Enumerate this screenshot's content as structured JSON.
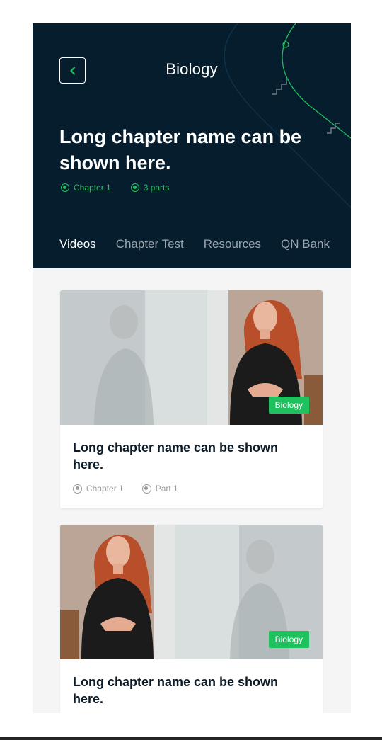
{
  "header": {
    "title": "Biology",
    "chapter_heading": "Long chapter name can be shown here.",
    "meta": [
      {
        "icon": "radio-icon",
        "label": "Chapter 1"
      },
      {
        "icon": "radio-icon",
        "label": "3 parts"
      }
    ],
    "back_icon": "chevron-left-icon"
  },
  "tabs": [
    {
      "label": "Videos",
      "active": true
    },
    {
      "label": "Chapter Test",
      "active": false
    },
    {
      "label": "Resources",
      "active": false
    },
    {
      "label": "QN Bank",
      "active": false
    }
  ],
  "cards": [
    {
      "badge": "Biology",
      "title": "Long chapter name can be shown here.",
      "meta": [
        {
          "icon": "radio-icon",
          "label": "Chapter 1"
        },
        {
          "icon": "radio-icon",
          "label": "Part 1"
        }
      ]
    },
    {
      "badge": "Biology",
      "title": "Long chapter name can be shown here.",
      "meta": []
    }
  ],
  "colors": {
    "header_bg": "#061d2e",
    "accent": "#1fc15e",
    "page_bg": "#f5f5f5",
    "title_text": "#0c1b28"
  }
}
